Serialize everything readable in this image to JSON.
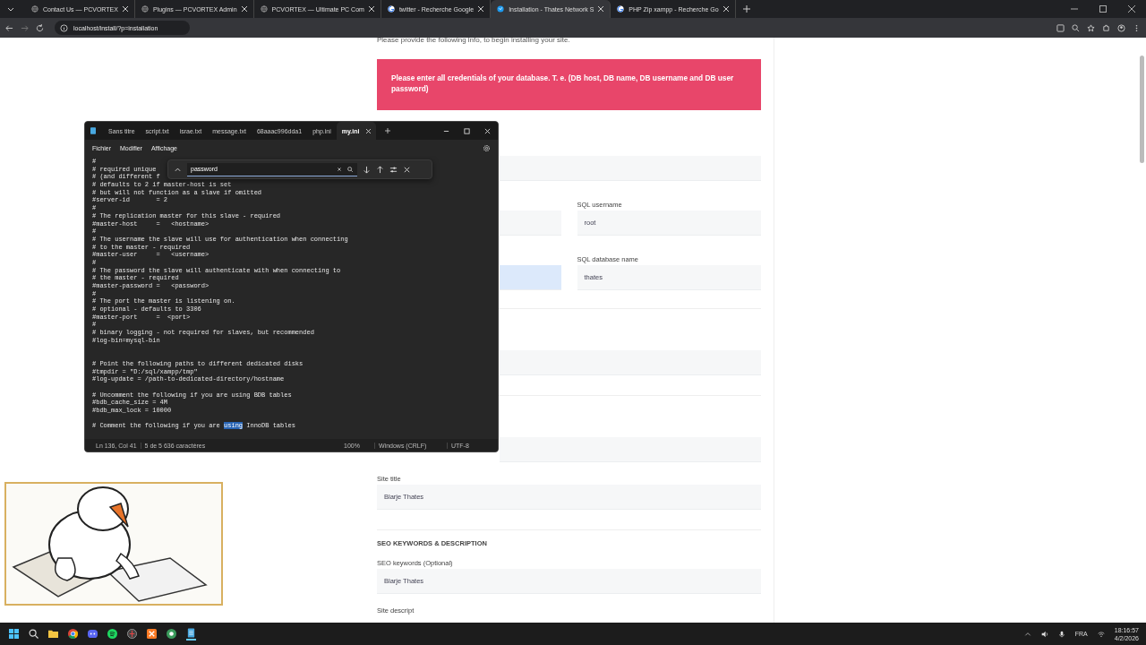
{
  "browser": {
    "tabs": [
      {
        "title": "Contact Us — PCVORTEX",
        "kind": "globe",
        "selected": false
      },
      {
        "title": "Plugins — PCVORTEX Admin",
        "kind": "globe",
        "selected": false
      },
      {
        "title": "PCVORTEX — Ultimate PC Com",
        "kind": "globe",
        "selected": false
      },
      {
        "title": "twitter - Recherche Google",
        "kind": "google",
        "selected": false
      },
      {
        "title": "Installation - Thates Network S",
        "kind": "site",
        "selected": true
      },
      {
        "title": "PHP Zip xampp - Recherche Go",
        "kind": "google",
        "selected": false
      }
    ],
    "url": "localhost/install/?p=installation"
  },
  "form": {
    "intro": "Please provide the following info, to begin installing your site.",
    "alert": "Please enter all credentials of your database. T. e. (DB host, DB name, DB username and DB user password)",
    "rows": [
      {
        "kind": "field"
      },
      {
        "kind": "pair",
        "left": {
          "focused": false
        },
        "right": {
          "label": "SQL username",
          "value": "root"
        }
      },
      {
        "kind": "pair",
        "left": {
          "focused": true
        },
        "right": {
          "label": "SQL database name",
          "value": "thates"
        }
      },
      {
        "kind": "divider"
      },
      {
        "kind": "field"
      },
      {
        "kind": "divider"
      },
      {
        "kind": "field"
      },
      {
        "kind": "field",
        "label": "Site title",
        "value": "Blarje Thates"
      },
      {
        "kind": "divider"
      },
      {
        "kind": "heading",
        "text": "SEO KEYWORDS & DESCRIPTION"
      },
      {
        "kind": "field",
        "label": "SEO keywords (Optional)",
        "value": "Blarje Thates"
      },
      {
        "kind": "label",
        "text": "Site descript"
      }
    ]
  },
  "notepad": {
    "tabs": [
      {
        "title": "Sans titre",
        "selected": false
      },
      {
        "title": "script.txt",
        "selected": false
      },
      {
        "title": "israe.txt",
        "selected": false
      },
      {
        "title": "message.txt",
        "selected": false
      },
      {
        "title": "68aaac996dda1",
        "selected": false
      },
      {
        "title": "php.ini",
        "selected": false
      },
      {
        "title": "my.ini",
        "selected": true
      }
    ],
    "menu": [
      "Fichier",
      "Modifier",
      "Affichage"
    ],
    "find": {
      "value": "password"
    },
    "lines": [
      {
        "kind": "text",
        "text": "#"
      },
      {
        "kind": "text",
        "text": "# required unique"
      },
      {
        "kind": "text",
        "text": "# (and different f"
      },
      {
        "kind": "text",
        "text": "# defaults to 2 if master-host is set"
      },
      {
        "kind": "text",
        "text": "# but will not function as a slave if omitted"
      },
      {
        "kind": "text",
        "text": "#server-id       = 2"
      },
      {
        "kind": "text",
        "text": "#"
      },
      {
        "kind": "text",
        "text": "# The replication master for this slave - required"
      },
      {
        "kind": "text",
        "text": "#master-host     =   <hostname>"
      },
      {
        "kind": "text",
        "text": "#"
      },
      {
        "kind": "text",
        "text": "# The username the slave will use for authentication when connecting"
      },
      {
        "kind": "text",
        "text": "# to the master - required"
      },
      {
        "kind": "text",
        "text": "#master-user     =   <username>"
      },
      {
        "kind": "text",
        "text": "#"
      },
      {
        "kind": "text",
        "text": "# The password the slave will authenticate with when connecting to"
      },
      {
        "kind": "text",
        "text": "# the master - required"
      },
      {
        "kind": "text",
        "text": "#master-password =   <password>"
      },
      {
        "kind": "text",
        "text": "#"
      },
      {
        "kind": "text",
        "text": "# The port the master is listening on."
      },
      {
        "kind": "text",
        "text": "# optional - defaults to 3306"
      },
      {
        "kind": "text",
        "text": "#master-port     =  <port>"
      },
      {
        "kind": "text",
        "text": "#"
      },
      {
        "kind": "text",
        "text": "# binary logging - not required for slaves, but recommended"
      },
      {
        "kind": "text",
        "text": "#log-bin=mysql-bin"
      },
      {
        "kind": "blank"
      },
      {
        "kind": "blank"
      },
      {
        "kind": "text",
        "text": "# Point the following paths to different dedicated disks"
      },
      {
        "kind": "text",
        "text": "#tmpdir = \"D:/sql/xampp/tmp\""
      },
      {
        "kind": "text",
        "text": "#log-update = /path-to-dedicated-directory/hostname"
      },
      {
        "kind": "blank"
      },
      {
        "kind": "text",
        "text": "# Uncomment the following if you are using BDB tables"
      },
      {
        "kind": "text",
        "text": "#bdb_cache_size = 4M"
      },
      {
        "kind": "text",
        "text": "#bdb_max_lock = 10000"
      },
      {
        "kind": "blank"
      },
      {
        "kind": "match",
        "before": "# Comment the following if you are ",
        "match": "using",
        "after": " InnoDB tables"
      }
    ],
    "status": {
      "position": "Ln 136, Col 41",
      "count": "5 de 5 636 caractères",
      "zoom": "100%",
      "eol": "Windows (CRLF)",
      "encoding": "UTF-8"
    }
  },
  "taskbar": {
    "language": "FRA",
    "time": "18:16:57",
    "date": "4/2/2026"
  }
}
